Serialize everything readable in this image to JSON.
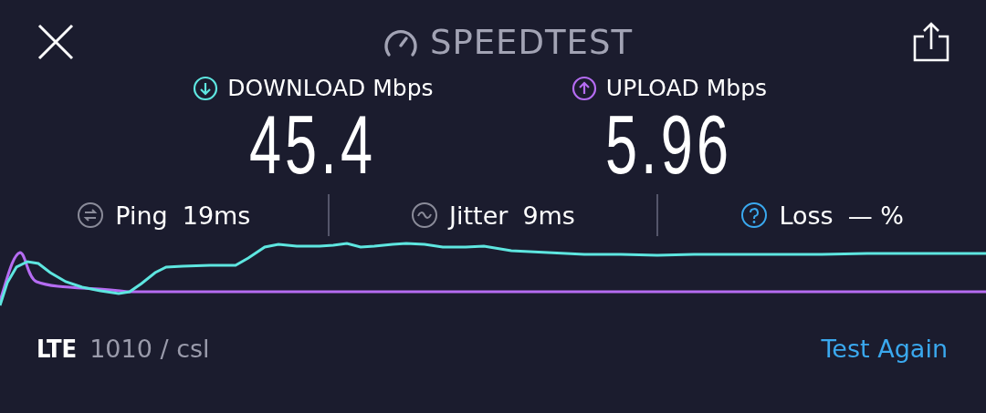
{
  "header": {
    "title": "SPEEDTEST"
  },
  "results": [
    {
      "kind": "download",
      "label": "DOWNLOAD",
      "unit": "Mbps",
      "value": "45.4",
      "color": "#5ee6e0"
    },
    {
      "kind": "upload",
      "label": "UPLOAD",
      "unit": "Mbps",
      "value": "5.96",
      "color": "#b56cf2"
    }
  ],
  "stats": [
    {
      "kind": "ping",
      "label": "Ping",
      "value": "19ms"
    },
    {
      "kind": "jitter",
      "label": "Jitter",
      "value": "9ms"
    },
    {
      "kind": "loss",
      "label": "Loss",
      "value": "— %"
    }
  ],
  "footer": {
    "network": "LTE",
    "provider": "1010 / csl",
    "button": "Test Again"
  }
}
